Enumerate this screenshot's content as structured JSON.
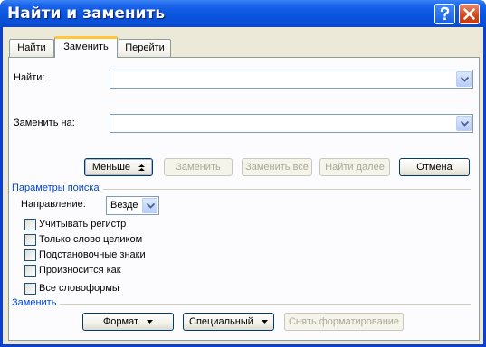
{
  "window": {
    "title": "Найти и заменить",
    "help_label": "?",
    "close_label": "×"
  },
  "tabs": [
    {
      "label": "Найти",
      "selected": false
    },
    {
      "label": "Заменить",
      "selected": true
    },
    {
      "label": "Перейти",
      "selected": false
    }
  ],
  "find": {
    "label": "Найти:",
    "value": ""
  },
  "replace": {
    "label": "Заменить на:",
    "value": ""
  },
  "buttons": {
    "less": "Меньше",
    "replace": "Заменить",
    "replace_all": "Заменить все",
    "find_next": "Найти далее",
    "cancel": "Отмена"
  },
  "search_options": {
    "title": "Параметры поиска",
    "direction_label": "Направление:",
    "direction_value": "Везде",
    "options": [
      {
        "label": "Учитывать регистр",
        "checked": false
      },
      {
        "label": "Только слово целиком",
        "checked": false
      },
      {
        "label": "Подстановочные знаки",
        "checked": false
      },
      {
        "label": "Произносится как",
        "checked": false
      },
      {
        "label": "Все словоформы",
        "checked": false
      }
    ]
  },
  "replace_section": {
    "title": "Заменить",
    "format_button": "Формат",
    "special_button": "Специальный",
    "clear_format_button": "Снять форматирование"
  },
  "colors": {
    "titlebar": "#0a55df",
    "group_title": "#0046d5",
    "dialog_face": "#ece9d8",
    "tab_highlight": "#ffc83c"
  }
}
